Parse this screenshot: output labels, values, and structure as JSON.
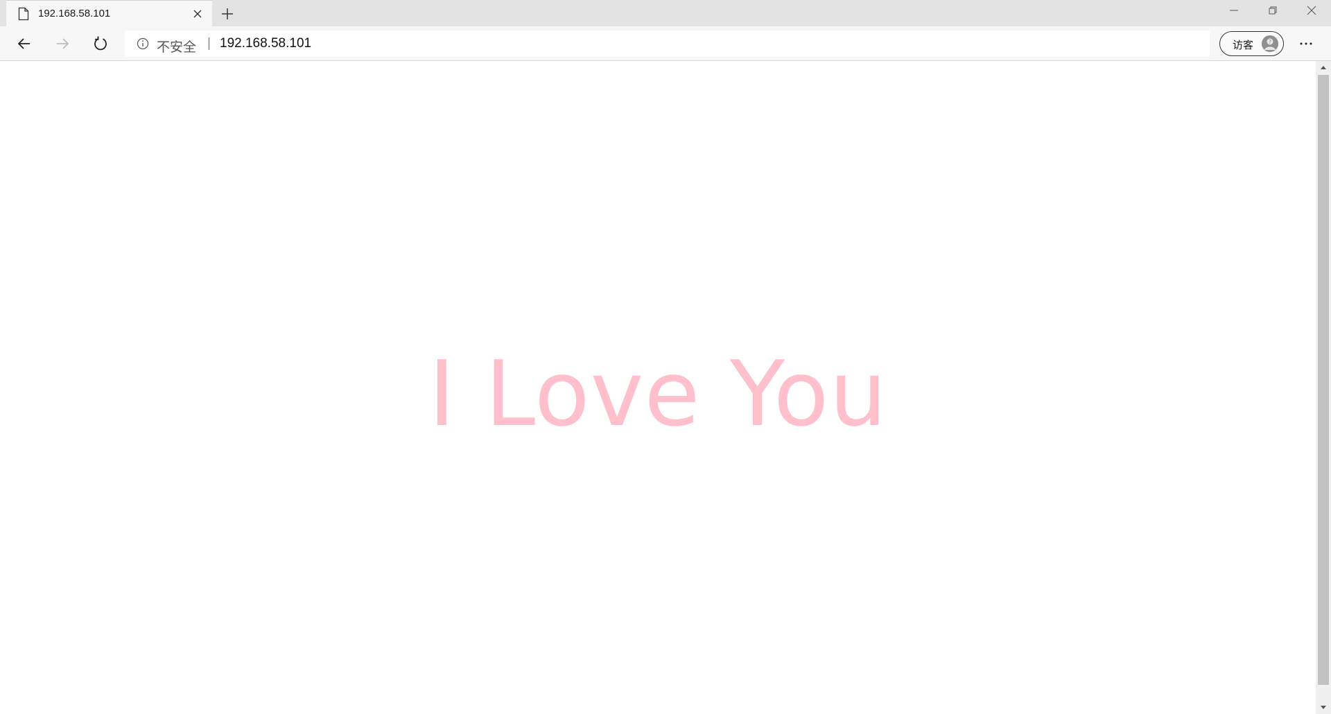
{
  "tab": {
    "title": "192.168.58.101",
    "icon": "page-icon"
  },
  "toolbar": {
    "back_icon": "back-arrow-icon",
    "forward_icon": "forward-arrow-icon",
    "refresh_icon": "refresh-icon",
    "security_label": "不安全",
    "separator": "|",
    "url": "192.168.58.101",
    "profile_label": "访客",
    "more_icon": "more-icon"
  },
  "window": {
    "controls": [
      "minimize",
      "restore",
      "close"
    ]
  },
  "content": {
    "headline": "I Love You",
    "headline_color": "#ffc0cb"
  }
}
